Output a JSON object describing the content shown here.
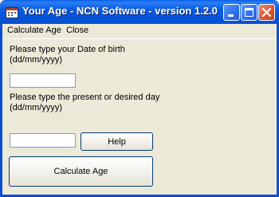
{
  "window": {
    "title": "Your Age - NCN Software - version 1.2.0",
    "app_icon": "calendar-app-icon",
    "controls": {
      "minimize_icon": "minimize-icon",
      "maximize_icon": "maximize-icon",
      "close_icon": "close-icon"
    }
  },
  "menu": {
    "items": [
      {
        "label": "Calculate Age"
      },
      {
        "label": "Close"
      }
    ]
  },
  "form": {
    "dob_label_line1": "Please type your Date of birth",
    "dob_label_line2": "(dd/mm/yyyy)",
    "dob_value": "",
    "present_label_line1": "Please type the present or desired day",
    "present_label_line2": "(dd/mm/yyyy)",
    "present_value": "",
    "help_button": "Help",
    "calculate_button": "Calculate Age"
  },
  "colors": {
    "titlebar": "#0a5ce0",
    "client_bg": "#ece9d8",
    "close_button": "#d9532d"
  }
}
